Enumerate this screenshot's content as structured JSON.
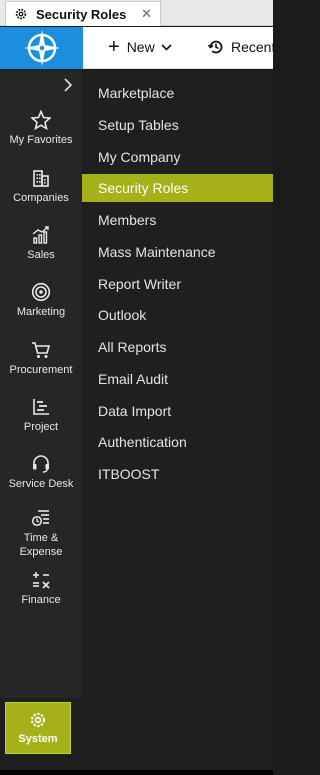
{
  "tab": {
    "title": "Security Roles",
    "close_glyph": "✕",
    "icon": "gear-icon"
  },
  "header": {
    "logo_icon": "compass-logo-icon",
    "new_label": "New",
    "recent_label": "Recent"
  },
  "sidebar": {
    "items": [
      {
        "label": "My Favorites",
        "icon": "star-icon"
      },
      {
        "label": "Companies",
        "icon": "building-icon"
      },
      {
        "label": "Sales",
        "icon": "chart-icon"
      },
      {
        "label": "Marketing",
        "icon": "target-icon"
      },
      {
        "label": "Procurement",
        "icon": "cart-icon"
      },
      {
        "label": "Project",
        "icon": "gantt-icon"
      },
      {
        "label": "Service Desk",
        "icon": "headset-icon"
      },
      {
        "label": "Time &",
        "label2": "Expense",
        "icon": "timesheet-icon"
      },
      {
        "label": "Finance",
        "icon": "calculator-icon"
      }
    ],
    "system_label": "System"
  },
  "menu": {
    "items": [
      "Marketplace",
      "Setup Tables",
      "My Company",
      "Security Roles",
      "Members",
      "Mass Maintenance",
      "Report Writer",
      "Outlook",
      "All Reports",
      "Email Audit",
      "Data Import",
      "Authentication",
      "ITBOOST"
    ],
    "active": "Security Roles"
  },
  "colors": {
    "accent": "#a6b019",
    "logo_bg": "#1c8ede",
    "sidebar_bg": "#262626",
    "menu_bg": "#1f1f1f"
  }
}
